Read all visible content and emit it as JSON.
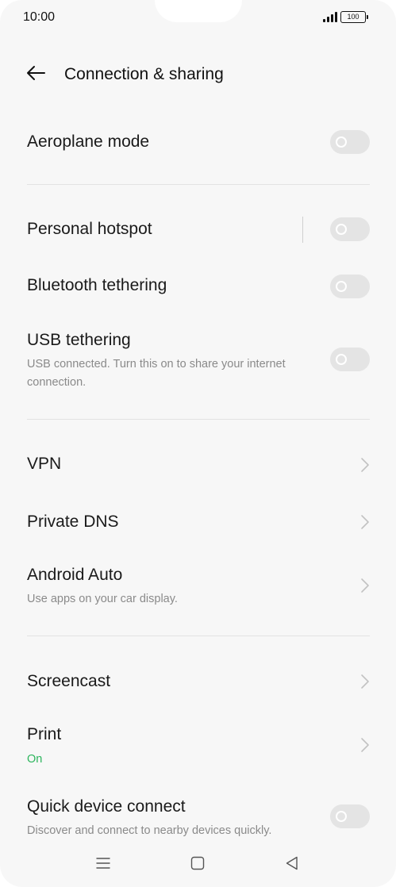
{
  "status_bar": {
    "time": "10:00",
    "battery": "100",
    "icons": [
      "signal-icon",
      "battery-icon"
    ]
  },
  "header": {
    "title": "Connection & sharing",
    "back_icon": "arrow-left-icon"
  },
  "items": [
    {
      "label": "Aeroplane mode",
      "control": "toggle",
      "enabled": false
    },
    {
      "label": "Personal hotspot",
      "control": "toggle",
      "enabled": false
    },
    {
      "label": "Bluetooth tethering",
      "control": "toggle",
      "enabled": false
    },
    {
      "label": "USB tethering",
      "subtitle": "USB connected. Turn this on to share your internet connection.",
      "control": "toggle",
      "enabled": false
    },
    {
      "label": "VPN",
      "control": "chevron"
    },
    {
      "label": "Private DNS",
      "control": "chevron"
    },
    {
      "label": "Android Auto",
      "subtitle": "Use apps on your car display.",
      "control": "chevron"
    },
    {
      "label": "Screencast",
      "control": "chevron"
    },
    {
      "label": "Print",
      "subtitle": "On",
      "control": "chevron"
    },
    {
      "label": "Quick device connect",
      "subtitle": "Discover and connect to nearby devices quickly.",
      "control": "toggle",
      "enabled": false
    }
  ],
  "nav_bar": {
    "icons": [
      "menu-icon",
      "home-icon",
      "back-triangle-icon"
    ]
  },
  "colors": {
    "background": "#f7f7f7",
    "toggle_off": "#e4e4e4",
    "subtitle": "#8a8a8a",
    "status_on": "#2db55d"
  }
}
